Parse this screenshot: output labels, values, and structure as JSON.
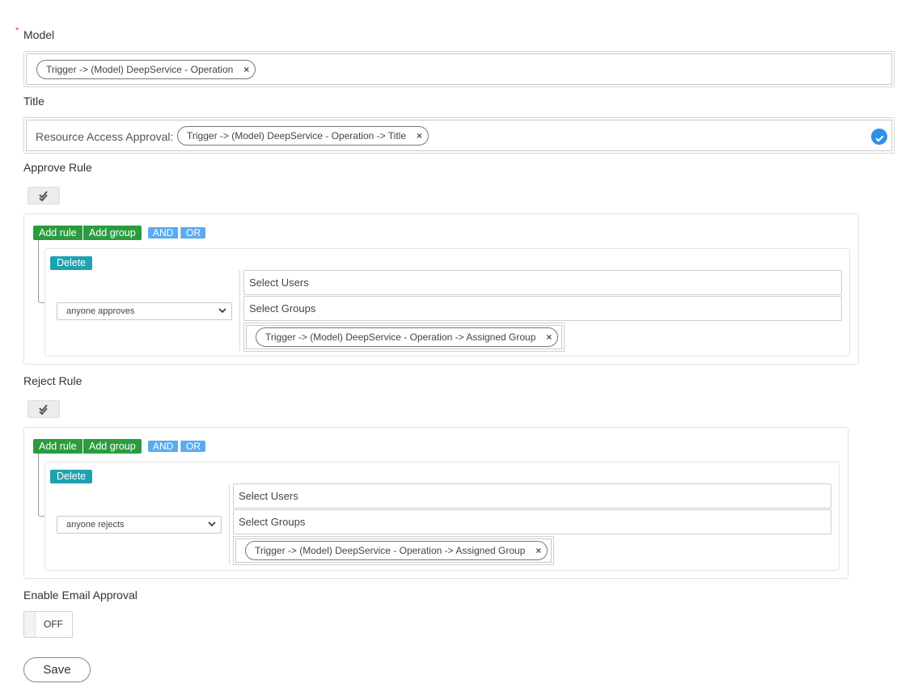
{
  "model": {
    "required_mark": "*",
    "label": "Model",
    "chip": "Trigger -> (Model) DeepService - Operation",
    "chip_remove": "×"
  },
  "title_field": {
    "label": "Title",
    "prefix": "Resource Access Approval:",
    "chip": "Trigger -> (Model) DeepService - Operation -> Title",
    "chip_remove": "×"
  },
  "approve_rule": {
    "label": "Approve Rule",
    "add_rule": "Add rule",
    "add_group": "Add group",
    "and": "AND",
    "or": "OR",
    "delete": "Delete",
    "select_value": "anyone approves",
    "users_placeholder": "Select Users",
    "groups_placeholder": "Select Groups",
    "chip": "Trigger -> (Model) DeepService - Operation -> Assigned Group",
    "chip_remove": "×"
  },
  "reject_rule": {
    "label": "Reject Rule",
    "add_rule": "Add rule",
    "add_group": "Add group",
    "and": "AND",
    "or": "OR",
    "delete": "Delete",
    "select_value": "anyone rejects",
    "users_placeholder": "Select Users",
    "groups_placeholder": "Select Groups",
    "chip": "Trigger -> (Model) DeepService - Operation -> Assigned Group",
    "chip_remove": "×"
  },
  "email_approval": {
    "label": "Enable Email Approval",
    "state": "OFF"
  },
  "save_label": "Save",
  "colors": {
    "green": "#2a9c3f",
    "blue": "#5aabf1",
    "teal": "#1fa2b0",
    "check": "#2f8fe8"
  }
}
